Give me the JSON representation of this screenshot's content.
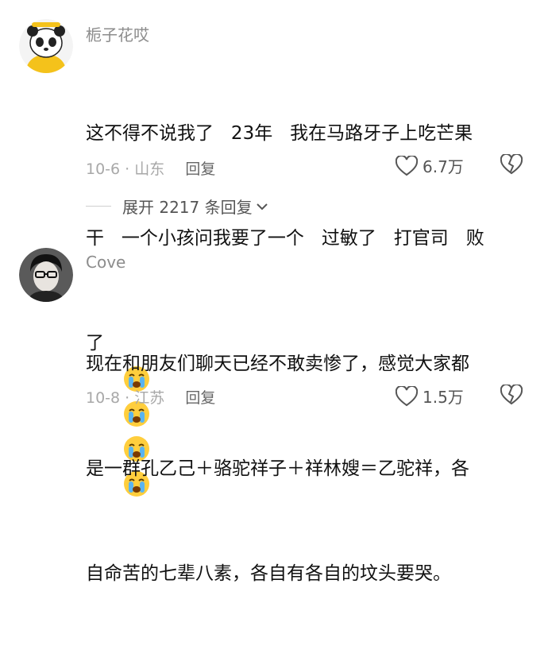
{
  "comments": [
    {
      "username": "栀子花哎",
      "text_line1": "这不得不说我了   23年   我在马路牙子上吃芒果",
      "text_line2": "干   一个小孩问我要了一个   过敏了   打官司   败",
      "text_line3": "了",
      "emoji_count": 4,
      "emoji_name": "crying-emoji",
      "date": "10-6",
      "location": "山东",
      "reply_label": "回复",
      "likes": "6.7万",
      "expand_label": "展开 2217 条回复"
    },
    {
      "username": "Cove",
      "text_line1": "现在和朋友们聊天已经不敢卖惨了，感觉大家都",
      "text_line2": "是一群孔乙己＋骆驼祥子＋祥林嫂＝乙驼祥，各",
      "text_line3": "自命苦的七辈八素，各自有各自的坟头要哭。",
      "date": "10-8",
      "location": "江苏",
      "reply_label": "回复",
      "likes": "1.5万"
    }
  ],
  "colors": {
    "meta": "#a8a8a8",
    "text": "#111111",
    "username": "#8c8c8c"
  }
}
